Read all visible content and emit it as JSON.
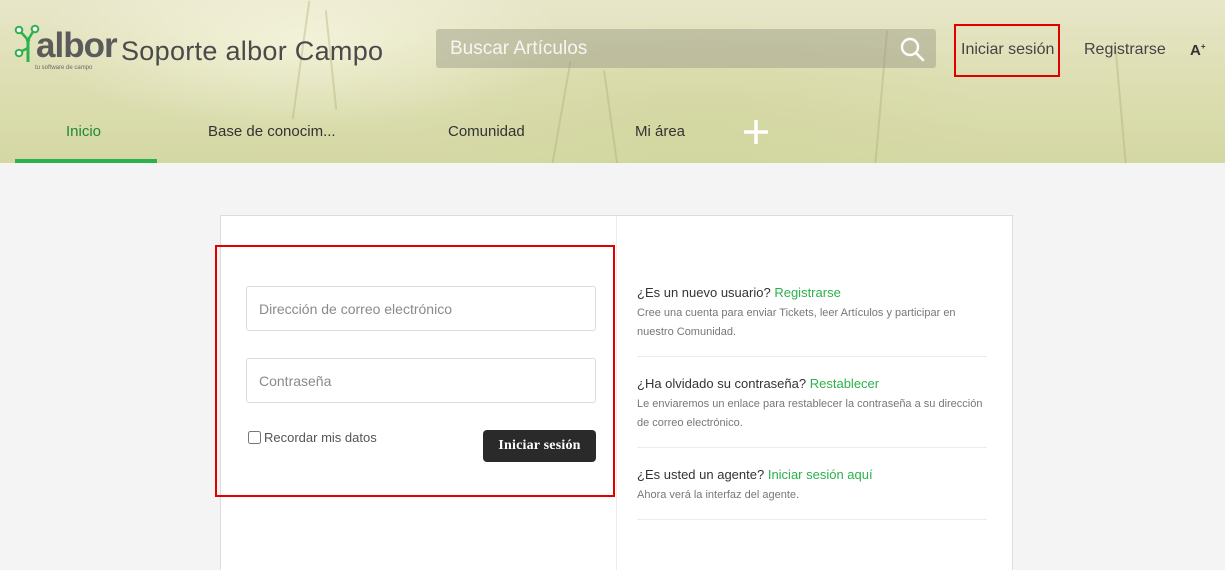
{
  "header": {
    "logo": {
      "name": "albor",
      "tagline": "tu software de campo"
    },
    "site_title": "Soporte albor Campo",
    "search": {
      "placeholder": "Buscar Artículos"
    },
    "login_link": "Iniciar sesión",
    "register_link": "Registrarse",
    "font_size_label": "A",
    "font_size_sup": "+",
    "colors": {
      "accent": "#2bb24c",
      "highlight": "#e00000"
    }
  },
  "nav": {
    "tabs": [
      {
        "label": "Inicio",
        "active": true
      },
      {
        "label": "Base de conocim..."
      },
      {
        "label": "Comunidad"
      },
      {
        "label": "Mi área"
      }
    ],
    "add_icon": "plus-icon"
  },
  "login": {
    "email_placeholder": "Dirección de correo electrónico",
    "password_placeholder": "Contraseña",
    "remember_label": "Recordar mis datos",
    "submit_label": "Iniciar sesión"
  },
  "info": [
    {
      "question": "¿Es un nuevo usuario?",
      "link": "Registrarse",
      "description": "Cree una cuenta para enviar Tickets, leer Artículos y participar en nuestro Comunidad."
    },
    {
      "question": "¿Ha olvidado su contraseña?",
      "link": "Restablecer",
      "description": "Le enviaremos un enlace para restablecer la contraseña a su dirección de correo electrónico."
    },
    {
      "question": "¿Es usted un agente?",
      "link": "Iniciar sesión aquí",
      "description": "Ahora verá la interfaz del agente."
    }
  ]
}
